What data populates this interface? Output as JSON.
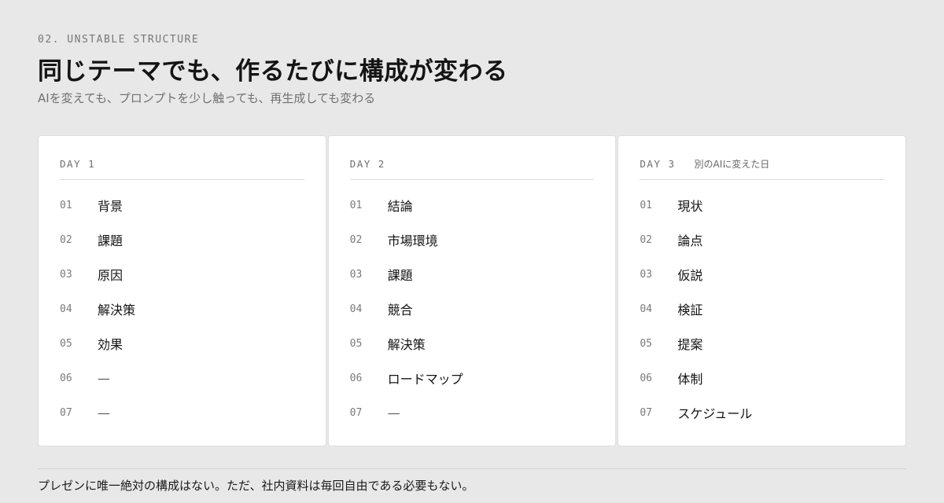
{
  "header": {
    "eyebrow": "02. UNSTABLE STRUCTURE",
    "title": "同じテーマでも、作るたびに構成が変わる",
    "subtitle": "AIを変えても、プロンプトを少し触っても、再生成しても変わる"
  },
  "cards": [
    {
      "label": "DAY 1",
      "note": "",
      "items": [
        {
          "num": "01",
          "text": "背景"
        },
        {
          "num": "02",
          "text": "課題"
        },
        {
          "num": "03",
          "text": "原因"
        },
        {
          "num": "04",
          "text": "解決策"
        },
        {
          "num": "05",
          "text": "効果"
        },
        {
          "num": "06",
          "text": "—"
        },
        {
          "num": "07",
          "text": "—"
        }
      ]
    },
    {
      "label": "DAY 2",
      "note": "",
      "items": [
        {
          "num": "01",
          "text": "結論"
        },
        {
          "num": "02",
          "text": "市場環境"
        },
        {
          "num": "03",
          "text": "課題"
        },
        {
          "num": "04",
          "text": "競合"
        },
        {
          "num": "05",
          "text": "解決策"
        },
        {
          "num": "06",
          "text": "ロードマップ"
        },
        {
          "num": "07",
          "text": "—"
        }
      ]
    },
    {
      "label": "DAY 3",
      "note": "別のAIに変えた日",
      "items": [
        {
          "num": "01",
          "text": "現状"
        },
        {
          "num": "02",
          "text": "論点"
        },
        {
          "num": "03",
          "text": "仮説"
        },
        {
          "num": "04",
          "text": "検証"
        },
        {
          "num": "05",
          "text": "提案"
        },
        {
          "num": "06",
          "text": "体制"
        },
        {
          "num": "07",
          "text": "スケジュール"
        }
      ]
    }
  ],
  "footer": {
    "text": "プレゼンに唯一絶対の構成はない。ただ、社内資料は毎回自由である必要もない。"
  }
}
